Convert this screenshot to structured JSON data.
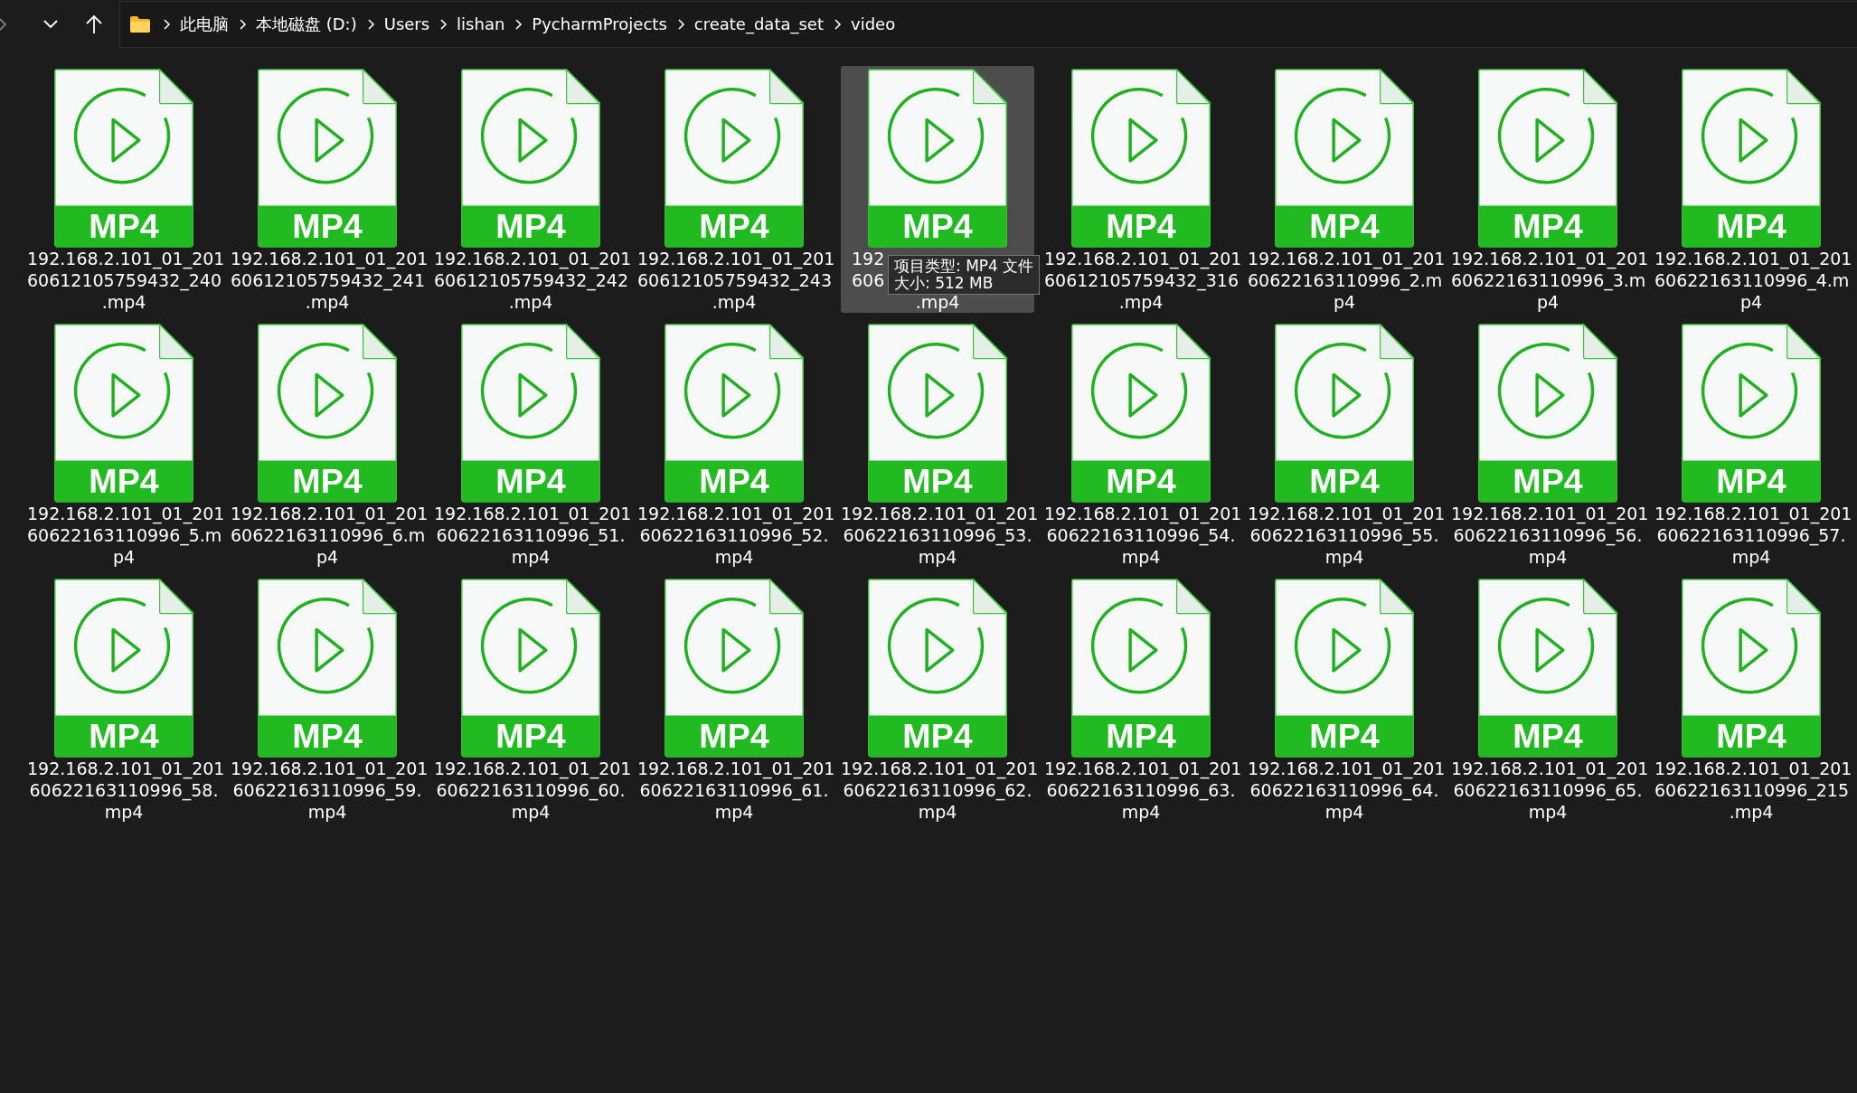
{
  "breadcrumb": [
    "此电脑",
    "本地磁盘 (D:)",
    "Users",
    "lishan",
    "PycharmProjects",
    "create_data_set",
    "video"
  ],
  "files": [
    {
      "badge": "MP4",
      "name_lines": [
        "192.168.2.101_01_201",
        "60612105759432_240",
        ".mp4"
      ],
      "hovered": false
    },
    {
      "badge": "MP4",
      "name_lines": [
        "192.168.2.101_01_201",
        "60612105759432_241",
        ".mp4"
      ],
      "hovered": false
    },
    {
      "badge": "MP4",
      "name_lines": [
        "192.168.2.101_01_201",
        "60612105759432_242",
        ".mp4"
      ],
      "hovered": false
    },
    {
      "badge": "MP4",
      "name_lines": [
        "192.168.2.101_01_201",
        "60612105759432_243",
        ".mp4"
      ],
      "hovered": false
    },
    {
      "badge": "MP4",
      "name_lines": [
        "192",
        "606",
        ".mp4"
      ],
      "hovered": true
    },
    {
      "badge": "MP4",
      "name_lines": [
        "192.168.2.101_01_201",
        "60612105759432_316",
        ".mp4"
      ],
      "hovered": false
    },
    {
      "badge": "MP4",
      "name_lines": [
        "192.168.2.101_01_201",
        "60622163110996_2.m",
        "p4"
      ],
      "hovered": false
    },
    {
      "badge": "MP4",
      "name_lines": [
        "192.168.2.101_01_201",
        "60622163110996_3.m",
        "p4"
      ],
      "hovered": false
    },
    {
      "badge": "MP4",
      "name_lines": [
        "192.168.2.101_01_201",
        "60622163110996_4.m",
        "p4"
      ],
      "hovered": false
    },
    {
      "badge": "MP4",
      "name_lines": [
        "192.168.2.101_01_201",
        "60622163110996_5.m",
        "p4"
      ],
      "hovered": false
    },
    {
      "badge": "MP4",
      "name_lines": [
        "192.168.2.101_01_201",
        "60622163110996_6.m",
        "p4"
      ],
      "hovered": false
    },
    {
      "badge": "MP4",
      "name_lines": [
        "192.168.2.101_01_201",
        "60622163110996_51.",
        "mp4"
      ],
      "hovered": false
    },
    {
      "badge": "MP4",
      "name_lines": [
        "192.168.2.101_01_201",
        "60622163110996_52.",
        "mp4"
      ],
      "hovered": false
    },
    {
      "badge": "MP4",
      "name_lines": [
        "192.168.2.101_01_201",
        "60622163110996_53.",
        "mp4"
      ],
      "hovered": false
    },
    {
      "badge": "MP4",
      "name_lines": [
        "192.168.2.101_01_201",
        "60622163110996_54.",
        "mp4"
      ],
      "hovered": false
    },
    {
      "badge": "MP4",
      "name_lines": [
        "192.168.2.101_01_201",
        "60622163110996_55.",
        "mp4"
      ],
      "hovered": false
    },
    {
      "badge": "MP4",
      "name_lines": [
        "192.168.2.101_01_201",
        "60622163110996_56.",
        "mp4"
      ],
      "hovered": false
    },
    {
      "badge": "MP4",
      "name_lines": [
        "192.168.2.101_01_201",
        "60622163110996_57.",
        "mp4"
      ],
      "hovered": false
    },
    {
      "badge": "MP4",
      "name_lines": [
        "192.168.2.101_01_201",
        "60622163110996_58.",
        "mp4"
      ],
      "hovered": false
    },
    {
      "badge": "MP4",
      "name_lines": [
        "192.168.2.101_01_201",
        "60622163110996_59.",
        "mp4"
      ],
      "hovered": false
    },
    {
      "badge": "MP4",
      "name_lines": [
        "192.168.2.101_01_201",
        "60622163110996_60.",
        "mp4"
      ],
      "hovered": false
    },
    {
      "badge": "MP4",
      "name_lines": [
        "192.168.2.101_01_201",
        "60622163110996_61.",
        "mp4"
      ],
      "hovered": false
    },
    {
      "badge": "MP4",
      "name_lines": [
        "192.168.2.101_01_201",
        "60622163110996_62.",
        "mp4"
      ],
      "hovered": false
    },
    {
      "badge": "MP4",
      "name_lines": [
        "192.168.2.101_01_201",
        "60622163110996_63.",
        "mp4"
      ],
      "hovered": false
    },
    {
      "badge": "MP4",
      "name_lines": [
        "192.168.2.101_01_201",
        "60622163110996_64.",
        "mp4"
      ],
      "hovered": false
    },
    {
      "badge": "MP4",
      "name_lines": [
        "192.168.2.101_01_201",
        "60622163110996_65.",
        "mp4"
      ],
      "hovered": false
    },
    {
      "badge": "MP4",
      "name_lines": [
        "192.168.2.101_01_201",
        "60622163110996_215",
        ".mp4"
      ],
      "hovered": false
    }
  ],
  "tooltip": {
    "lines": [
      "项目类型: MP4 文件",
      "大小: 512 MB"
    ]
  }
}
